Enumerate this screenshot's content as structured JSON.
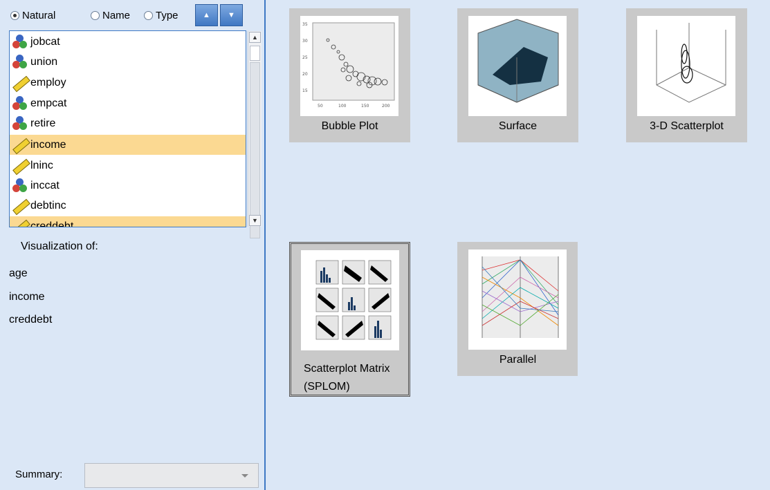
{
  "sort_options": {
    "natural": "Natural",
    "name": "Name",
    "type": "Type",
    "selected": "natural"
  },
  "sort_buttons": {
    "ascending_icon": "sort-ascending-icon",
    "descending_icon": "sort-descending-icon"
  },
  "variables": [
    {
      "name": "jobcat",
      "kind": "nominal",
      "selected": false
    },
    {
      "name": "union",
      "kind": "nominal",
      "selected": false
    },
    {
      "name": "employ",
      "kind": "scale",
      "selected": false
    },
    {
      "name": "empcat",
      "kind": "nominal",
      "selected": false
    },
    {
      "name": "retire",
      "kind": "nominal",
      "selected": false
    },
    {
      "name": "income",
      "kind": "scale",
      "selected": true
    },
    {
      "name": "lninc",
      "kind": "scale",
      "selected": false
    },
    {
      "name": "inccat",
      "kind": "nominal",
      "selected": false
    },
    {
      "name": "debtinc",
      "kind": "scale",
      "selected": false
    },
    {
      "name": "creddebt",
      "kind": "scale",
      "selected": true
    }
  ],
  "visualization": {
    "label": "Visualization of:",
    "fields": [
      "age",
      "income",
      "creddebt"
    ]
  },
  "summary": {
    "label": "Summary:",
    "value": ""
  },
  "gallery": [
    {
      "label": "Bubble Plot",
      "selected": false
    },
    {
      "label": "Surface",
      "selected": false
    },
    {
      "label": "3-D Scatterplot",
      "selected": false
    },
    {
      "label": "Scatterplot Matrix (SPLOM)",
      "selected": true
    },
    {
      "label": "Parallel",
      "selected": false
    }
  ],
  "colors": {
    "panel_bg": "#dbe7f6",
    "selection": "#fbd992",
    "accent": "#3d78c4"
  }
}
